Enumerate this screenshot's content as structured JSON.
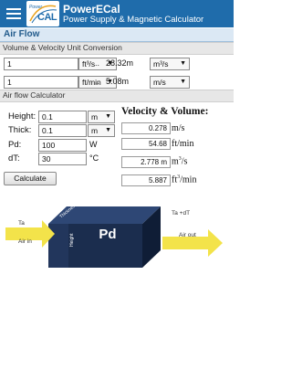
{
  "app": {
    "logo_line1": "Power",
    "logo_line2": "CAL",
    "title": "PowerECal",
    "subtitle": "Power Supply & Magnetic Calculator"
  },
  "section_title": "Air Flow",
  "conversion": {
    "heading": "Volume & Velocity Unit Conversion",
    "rows": [
      {
        "input": "1",
        "from_unit": "ft³/s",
        "separator": "..",
        "result": "28.32m",
        "to_unit": "m³/s"
      },
      {
        "input": "1",
        "from_unit": "ft/min",
        "separator": "..",
        "result": "5.08m",
        "to_unit": "m/s"
      }
    ]
  },
  "calculator": {
    "heading": "Air flow Calculator",
    "height": {
      "label": "Height:",
      "value": "0.1",
      "unit": "m"
    },
    "thick": {
      "label": "Thick:",
      "value": "0.1",
      "unit": "m"
    },
    "pd": {
      "label": "Pd:",
      "value": "100",
      "unit": "W"
    },
    "dt": {
      "label": "dT:",
      "value": "30",
      "unit": "°C"
    },
    "calculate_label": "Calculate",
    "results_heading": "Velocity & Volume:",
    "results": [
      {
        "value": "0.278",
        "unit": "m/s"
      },
      {
        "value": "54.68",
        "unit": "ft/min"
      },
      {
        "value": "2.778 m",
        "unit": "m³/s"
      },
      {
        "value": "5.887",
        "unit": "ft³/min"
      }
    ]
  },
  "diagram": {
    "box_label": "Pd",
    "top_label": "Thickness",
    "side_label": "Height",
    "in_temp": "Ta",
    "in_label": "Air in",
    "out_temp": "Ta +dT",
    "out_label": "Air out",
    "colors": {
      "box_front": "#1b2d4e",
      "box_top": "#2e4775",
      "box_side": "#0f1d36",
      "arrow": "#f3e34a"
    }
  }
}
